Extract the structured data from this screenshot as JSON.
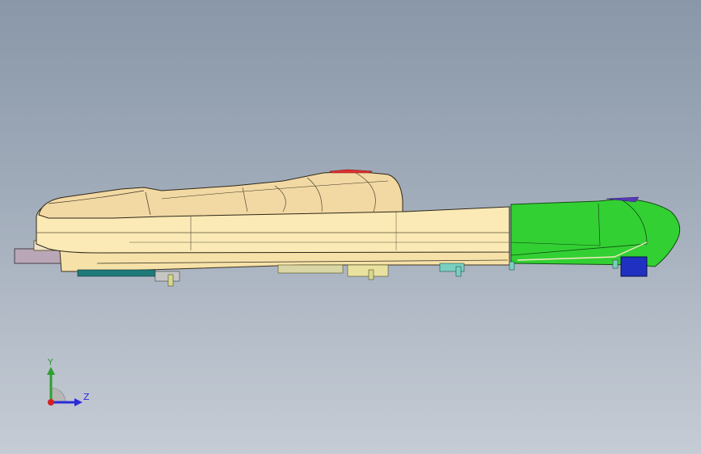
{
  "viewport": {
    "background_top": "#8997a8",
    "background_bottom": "#c6ccd5"
  },
  "model": {
    "body_color": "#fbeab5",
    "cover_color": "#f2d9a4",
    "head_color": "#33d033",
    "connector_color": "#2030c0",
    "detail_color": "#c6c6c6"
  },
  "triad": {
    "y_label": "Y",
    "z_label": "Z",
    "y_color": "#2fa02f",
    "z_color": "#2b2bd8",
    "origin_color": "#d62020"
  }
}
